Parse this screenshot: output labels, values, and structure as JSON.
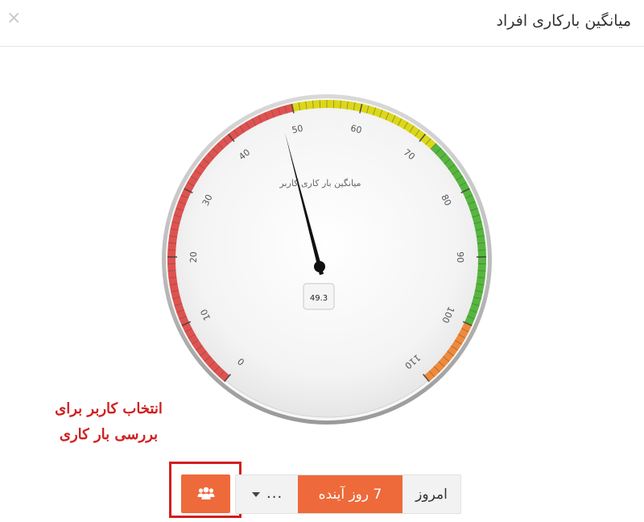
{
  "header": {
    "title": "میانگین بارکاری افراد",
    "close_label": "×"
  },
  "gauge": {
    "title": "میانگین بار کاری کاربر",
    "value": 49.3,
    "value_label": "49.3",
    "min": 0,
    "max": 110,
    "tick_labels": [
      "0",
      "10",
      "20",
      "30",
      "40",
      "50",
      "60",
      "70",
      "80",
      "90",
      "100",
      "110"
    ],
    "bands": [
      {
        "from": 0,
        "to": 50,
        "color": "#e0524f"
      },
      {
        "from": 50,
        "to": 72,
        "color": "#dcd717"
      },
      {
        "from": 72,
        "to": 100,
        "color": "#55b73d"
      },
      {
        "from": 100,
        "to": 110,
        "color": "#f08a3a"
      }
    ]
  },
  "annotation": {
    "line1": "انتخاب کاربر برای",
    "line2": "بررسی بار کاری"
  },
  "toolbar": {
    "users_icon": "users-icon",
    "dropdown_value": "...",
    "next_week_label": "7 روز آینده",
    "today_label": "امروز"
  },
  "colors": {
    "accent": "#ee6a3a",
    "annotation": "#d11f1f"
  }
}
